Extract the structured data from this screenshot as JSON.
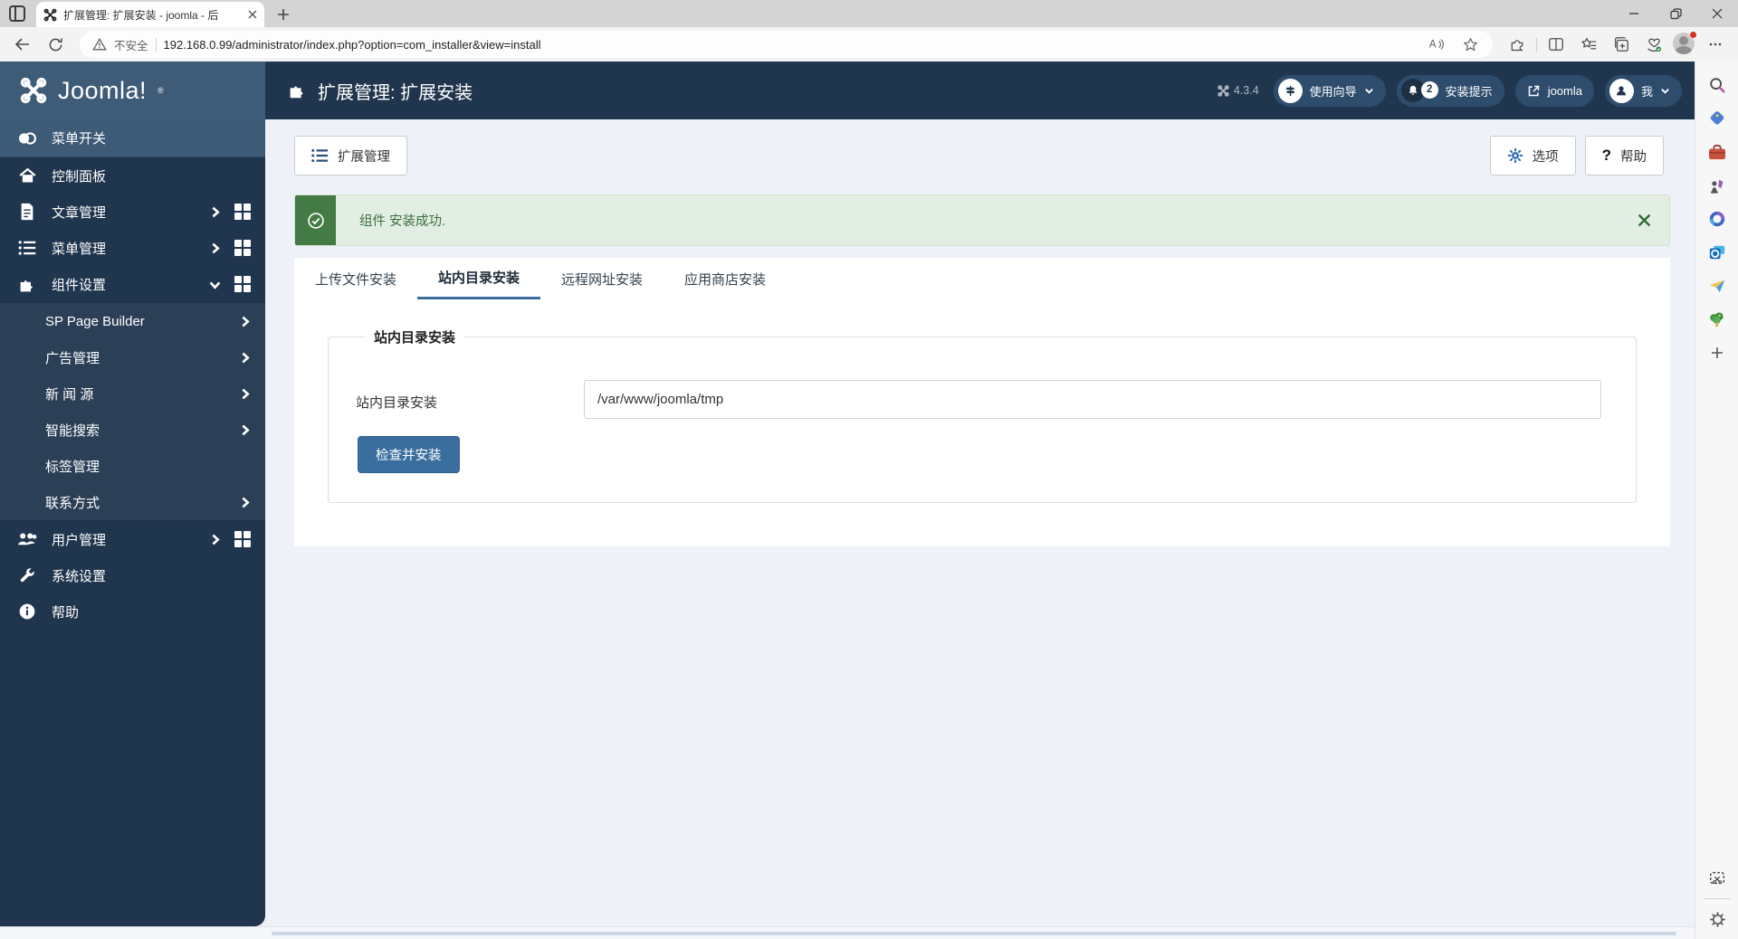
{
  "colors": {
    "accent": "#3a6e9e",
    "success": "#447a44",
    "header_navy": "#20364e",
    "sidebar_highlight": "#3d5a76"
  },
  "browser": {
    "tab_title": "扩展管理: 扩展安装 - joomla - 后",
    "security_label": "不安全",
    "url": "192.168.0.99/administrator/index.php?option=com_installer&view=install",
    "toolbar_icons": [
      "back",
      "refresh",
      "warning",
      "read-aloud",
      "favorite-star",
      "extensions",
      "split-screen",
      "favorites-list",
      "collections",
      "browser-essentials",
      "profile",
      "more"
    ],
    "rail_icons": [
      "search",
      "shopping",
      "toolbox",
      "games",
      "copilot",
      "outlook",
      "drop",
      "tree",
      "add",
      "snip",
      "settings"
    ]
  },
  "header": {
    "logo_text": "Joomla!",
    "logo_reg": "®",
    "page_title": "扩展管理: 扩展安装",
    "version": "4.3.4",
    "guide_label": "使用向导",
    "notify_count": "2",
    "notify_label": "安装提示",
    "site_label": "joomla",
    "user_label": "我"
  },
  "sidebar": {
    "toggle_label": "菜单开关",
    "items": [
      {
        "label": "控制面板"
      },
      {
        "label": "文章管理"
      },
      {
        "label": "菜单管理"
      },
      {
        "label": "组件设置",
        "children": [
          {
            "label": "SP Page Builder"
          },
          {
            "label": "广告管理"
          },
          {
            "label": "新 闻 源"
          },
          {
            "label": "智能搜索"
          },
          {
            "label": "标签管理"
          },
          {
            "label": "联系方式"
          }
        ]
      },
      {
        "label": "用户管理"
      },
      {
        "label": "系统设置"
      },
      {
        "label": "帮助"
      }
    ]
  },
  "toolbar": {
    "extensions_label": "扩展管理",
    "options_label": "选项",
    "help_label": "帮助"
  },
  "alert": {
    "message": "组件 安装成功."
  },
  "tabs": [
    "上传文件安装",
    "站内目录安装",
    "远程网址安装",
    "应用商店安装"
  ],
  "active_tab": "站内目录安装",
  "form": {
    "legend": "站内目录安装",
    "field_label": "站内目录安装",
    "field_value": "/var/www/joomla/tmp",
    "submit_label": "检查并安装"
  }
}
